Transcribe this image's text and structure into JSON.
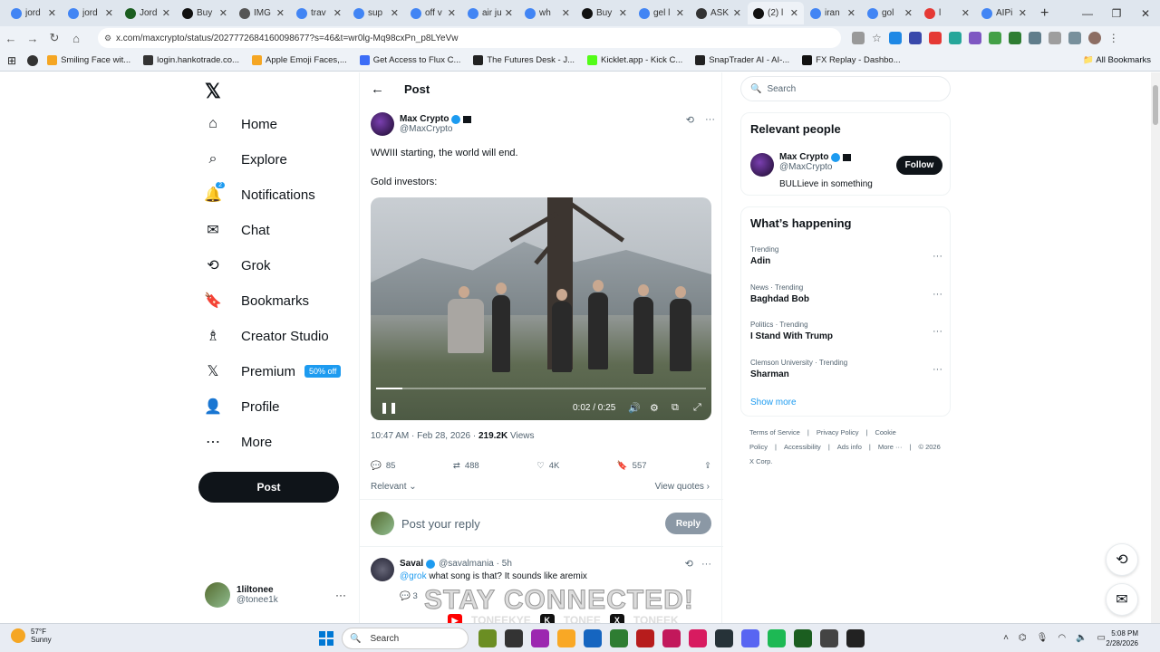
{
  "browser": {
    "tabs": [
      {
        "label": "jord"
      },
      {
        "label": "jord"
      },
      {
        "label": "Jord"
      },
      {
        "label": "Buy"
      },
      {
        "label": "IMG"
      },
      {
        "label": "trav"
      },
      {
        "label": "sup"
      },
      {
        "label": "off v"
      },
      {
        "label": "air ju"
      },
      {
        "label": "wh"
      },
      {
        "label": "Buy"
      },
      {
        "label": "gel l"
      },
      {
        "label": "ASK"
      },
      {
        "label": "(2) l"
      },
      {
        "label": "iran"
      },
      {
        "label": "gol"
      },
      {
        "label": "l"
      },
      {
        "label": "AIPi"
      }
    ],
    "active_tab_index": 13,
    "url": "x.com/maxcrypto/status/2027772684160098677?s=46&t=wr0lg-Mq98cxPn_p8LYeVw",
    "bookmarks": [
      {
        "label": "Smiling Face wit...",
        "color": "#f5a623"
      },
      {
        "label": "login.hankotrade.co...",
        "color": "#333333"
      },
      {
        "label": "Apple Emoji Faces,...",
        "color": "#f5a623"
      },
      {
        "label": "Get Access to Flux C...",
        "color": "#3b6cf6"
      },
      {
        "label": "The Futures Desk - J...",
        "color": "#222222"
      },
      {
        "label": "Kicklet.app - Kick C...",
        "color": "#53fc18"
      },
      {
        "label": "SnapTrader AI - AI-...",
        "color": "#222222"
      },
      {
        "label": "FX Replay - Dashbo...",
        "color": "#111111"
      }
    ],
    "all_bookmarks": "All Bookmarks"
  },
  "leftnav": {
    "items": [
      {
        "label": "Home",
        "icon": "home-icon"
      },
      {
        "label": "Explore",
        "icon": "search-icon"
      },
      {
        "label": "Notifications",
        "icon": "bell-icon",
        "badge": "2"
      },
      {
        "label": "Chat",
        "icon": "mail-icon"
      },
      {
        "label": "Grok",
        "icon": "grok-icon"
      },
      {
        "label": "Bookmarks",
        "icon": "bookmark-icon"
      },
      {
        "label": "Creator Studio",
        "icon": "creator-icon"
      },
      {
        "label": "Premium",
        "icon": "x-icon",
        "badge": "50% off"
      },
      {
        "label": "Profile",
        "icon": "person-icon"
      },
      {
        "label": "More",
        "icon": "more-icon"
      }
    ],
    "post_button": "Post",
    "account": {
      "display_name": "1liltonee",
      "handle": "@tonee1k"
    }
  },
  "main": {
    "header": "Post",
    "post": {
      "author_name": "Max Crypto",
      "author_handle": "@MaxCrypto",
      "text1": "WWIII starting, the world will end.",
      "text2": "Gold investors:",
      "video_time": "0:02 / 0:25",
      "video_progress": 0.08,
      "timestamp": "10:47 AM · Feb 28, 2026 · ",
      "views_count": "219.2K",
      "views_label": " Views",
      "replies": "85",
      "reposts": "488",
      "likes": "4K",
      "bookmarks": "557"
    },
    "sort_label": "Relevant",
    "view_quotes": "View quotes",
    "reply_placeholder": "Post your reply",
    "reply_button": "Reply",
    "replies": [
      {
        "name": "Saval",
        "handle": "@savalmania · 5h",
        "mention": "@grok",
        "text": " what song is that? It sounds like aremix",
        "reply_count": "3"
      }
    ]
  },
  "right": {
    "search_placeholder": "Search",
    "relevant_people_title": "Relevant people",
    "person": {
      "name": "Max Crypto",
      "handle": "@MaxCrypto",
      "bio": "BULLieve in something",
      "follow": "Follow"
    },
    "whats_happening_title": "What’s happening",
    "trends": [
      {
        "context": "Trending",
        "title": "Adin"
      },
      {
        "context": "News · Trending",
        "title": "Baghdad Bob"
      },
      {
        "context": "Politics · Trending",
        "title": "I Stand With Trump"
      },
      {
        "context": "Clemson University · Trending",
        "title": "Sharman"
      }
    ],
    "show_more": "Show more",
    "footer": [
      "Terms of Service",
      "Privacy Policy",
      "Cookie Policy",
      "Accessibility",
      "Ads info",
      "More ···",
      "© 2026 X Corp."
    ]
  },
  "overlay": {
    "headline": "STAY CONNECTED!",
    "handles": [
      "TONEEKYE",
      "TONEE",
      "TONEEK"
    ]
  },
  "taskbar": {
    "temp": "57°F",
    "weather": "Sunny",
    "search": "Search",
    "time": "5:08 PM",
    "date": "2/28/2026"
  }
}
